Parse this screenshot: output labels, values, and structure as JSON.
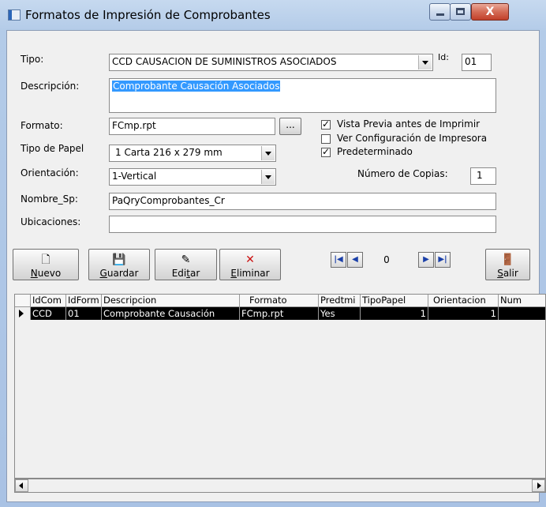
{
  "window": {
    "title": "Formatos de Impresión de Comprobantes",
    "close_glyph": "X"
  },
  "form": {
    "tipo_label": "Tipo:",
    "tipo_value": "CCD  CAUSACION DE SUMINISTROS ASOCIADOS",
    "id_label": "Id:",
    "id_value": "01",
    "descripcion_label": "Descripción:",
    "descripcion_value": "Comprobante Causación Asociados",
    "formato_label": "Formato:",
    "formato_value": "FCmp.rpt",
    "browse_label": "...",
    "tipo_papel_label": "Tipo de Papel",
    "tipo_papel_value": "1  Carta 216 x 279 mm",
    "orientacion_label": "Orientación:",
    "orientacion_value": "1-Vertical",
    "nombre_sp_label": "Nombre_Sp:",
    "nombre_sp_value": "PaQryComprobantes_Cr",
    "ubicaciones_label": "Ubicaciones:",
    "ubicaciones_value": "",
    "vista_previa_label": "Vista Previa antes de Imprimir",
    "vista_previa_checked": true,
    "ver_config_label": "Ver Configuración de Impresora",
    "ver_config_checked": false,
    "predeterminado_label": "Predeterminado",
    "predeterminado_checked": true,
    "num_copias_label": "Número de Copias:",
    "num_copias_value": "1"
  },
  "toolbar": {
    "nuevo_mnemonic": "N",
    "nuevo_rest": "uevo",
    "guardar_mnemonic": "G",
    "guardar_rest": "uardar",
    "editar_pre": "Edi",
    "editar_mnemonic": "t",
    "editar_rest": "ar",
    "eliminar_mnemonic": "E",
    "eliminar_rest": "liminar",
    "salir_mnemonic": "S",
    "salir_rest": "alir",
    "nav_position": "0"
  },
  "grid": {
    "columns": [
      "IdCom",
      "IdForm",
      "Descripcion",
      "Formato",
      "Predtmi",
      "TipoPapel",
      "Orientacion",
      "Num"
    ],
    "rows": [
      {
        "idcom": "CCD",
        "idform": "01",
        "descripcion": "Comprobante Causación",
        "formato": "FCmp.rpt",
        "predtm": "Yes",
        "tipopapel": "1",
        "orientacion": "1",
        "num": ""
      }
    ]
  }
}
